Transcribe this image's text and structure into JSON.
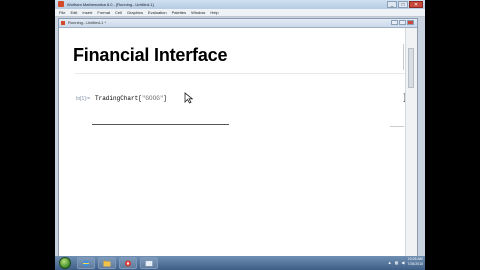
{
  "app": {
    "window_title": "Wolfram Mathematica 8.0 - [Running...Untitled-1]",
    "win_minimize": "_",
    "win_maximize": "□",
    "win_close": "✕"
  },
  "menubar": {
    "items": [
      "File",
      "Edit",
      "Insert",
      "Format",
      "Cell",
      "Graphics",
      "Evaluation",
      "Palettes",
      "Window",
      "Help"
    ]
  },
  "notebook": {
    "window_title": "Running...Untitled-1 *",
    "heading": "Financial Interface",
    "input_label": "In[1]:=",
    "code_function": "TradingChart[",
    "code_string": "\"GOOG\"",
    "code_close": "]",
    "right_bracket": "]",
    "zoom": "100%"
  },
  "taskbar": {
    "clock_time": "10:26 AM",
    "clock_date": "7/26/2010"
  },
  "colors": {
    "taskbar": "#4c6d96",
    "title_bar": "#c5d7ea",
    "heading_text": "#000000",
    "input_label": "#7c90a6"
  }
}
